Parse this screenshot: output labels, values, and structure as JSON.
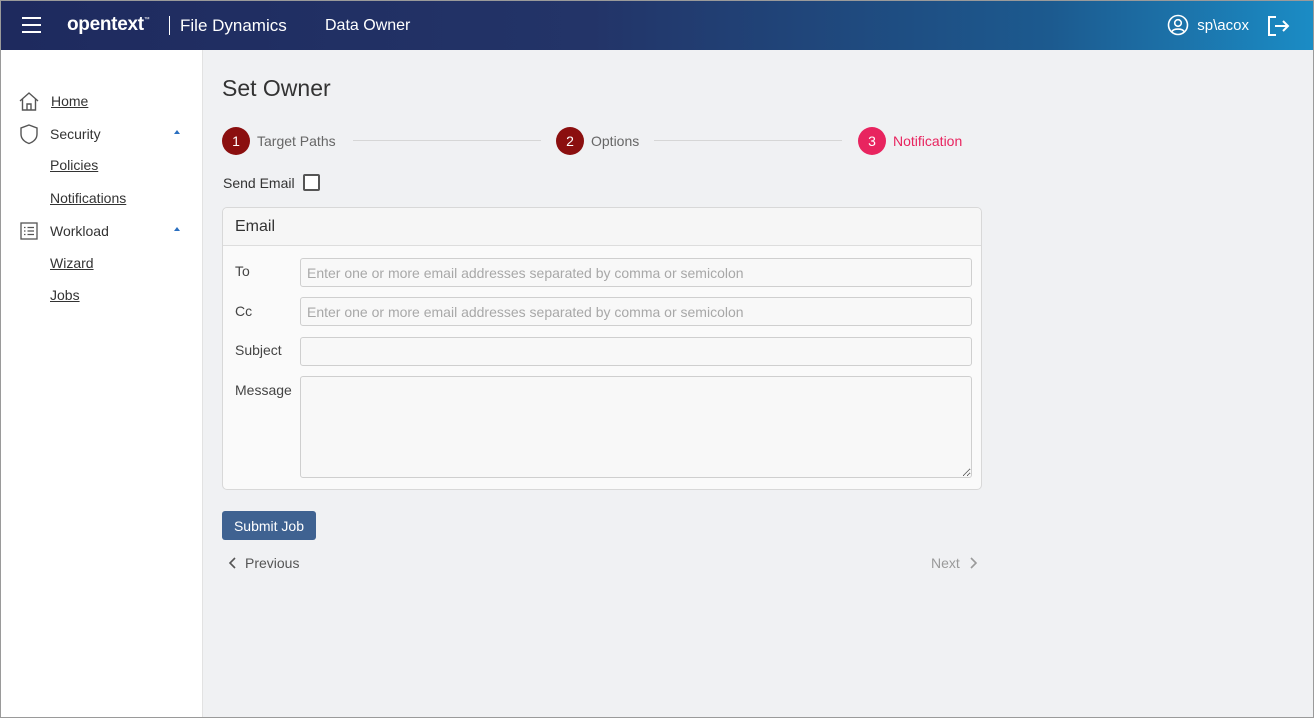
{
  "header": {
    "brand": "opentext",
    "brand_mark": "™",
    "product": "File Dynamics",
    "section": "Data Owner",
    "user": "sp\\acox"
  },
  "sidebar": {
    "items": [
      {
        "label": "Home",
        "icon": "home-icon"
      },
      {
        "label": "Security",
        "icon": "shield-icon"
      },
      {
        "label": "Policies"
      },
      {
        "label": "Notifications"
      },
      {
        "label": "Workload",
        "icon": "list-icon"
      },
      {
        "label": "Wizard"
      },
      {
        "label": "Jobs"
      }
    ]
  },
  "main": {
    "title": "Set Owner",
    "steps": [
      {
        "number": "1",
        "label": "Target Paths",
        "state": "complete"
      },
      {
        "number": "2",
        "label": "Options",
        "state": "complete"
      },
      {
        "number": "3",
        "label": "Notification",
        "state": "active"
      }
    ],
    "send_email_label": "Send Email",
    "send_email_checked": false,
    "email_panel": {
      "title": "Email",
      "to_label": "To",
      "to_value": "",
      "to_placeholder": "Enter one or more email addresses separated by comma or semicolon",
      "cc_label": "Cc",
      "cc_value": "",
      "cc_placeholder": "Enter one or more email addresses separated by comma or semicolon",
      "subject_label": "Subject",
      "subject_value": "",
      "message_label": "Message",
      "message_value": ""
    },
    "submit_label": "Submit Job",
    "previous_label": "Previous",
    "next_label": "Next"
  },
  "colors": {
    "step_complete": "#8b0f0f",
    "step_active": "#e8245f",
    "step_active_text": "#e8245f",
    "submit_bg": "#3f6291"
  }
}
